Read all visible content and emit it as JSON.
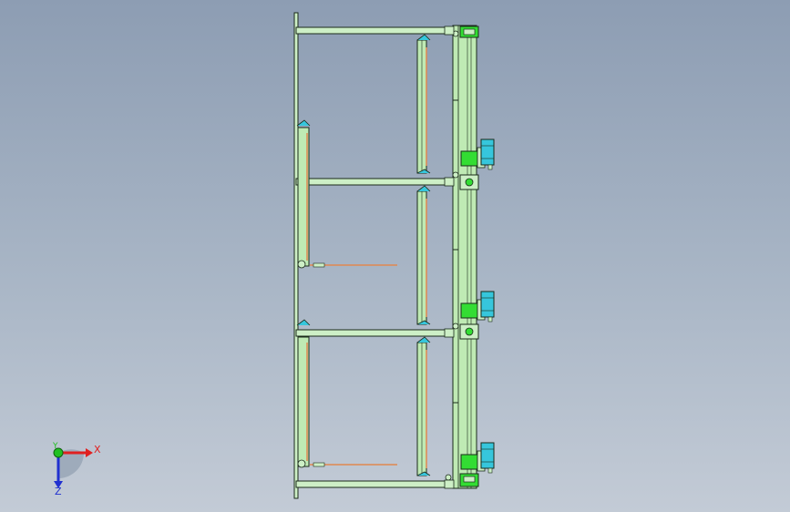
{
  "triad": {
    "x_label": "X",
    "y_label": "Y",
    "z_label": "Z",
    "x_color": "#e02020",
    "y_color": "#20c020",
    "z_color": "#2030d0"
  },
  "colors": {
    "background_top": "#8d9db3",
    "background_bottom": "#c3cbd6",
    "frame_fill": "#cdefc6",
    "frame_edge": "#1a2a1a",
    "rail_fill": "#bfeab4",
    "bright_green": "#33dd33",
    "cyan_motor": "#36c6dc",
    "orange_rod": "#e08850"
  },
  "components": {
    "motor_icon": "motor-icon",
    "roller_icon": "roller-icon"
  }
}
